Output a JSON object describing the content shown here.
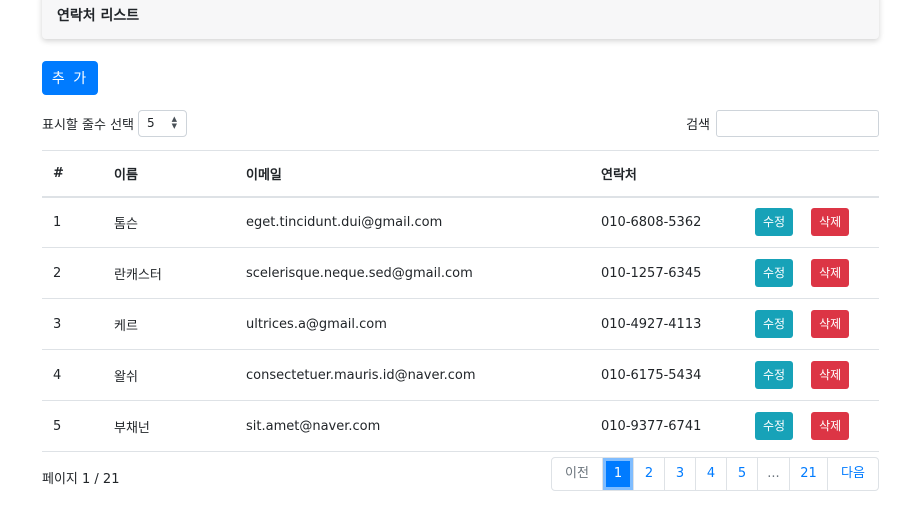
{
  "card": {
    "title": "연락처 리스트"
  },
  "toolbar": {
    "add_label": "추 가",
    "rows_label": "표시할 줄수 선택",
    "rows_value": "5",
    "search_label": "검색",
    "search_value": ""
  },
  "table": {
    "headers": [
      "#",
      "이름",
      "이메일",
      "연락처"
    ],
    "edit_label": "수정",
    "delete_label": "삭제",
    "rows": [
      {
        "num": "1",
        "name": "톰슨",
        "email": "eget.tincidunt.dui@gmail.com",
        "phone": "010-6808-5362"
      },
      {
        "num": "2",
        "name": "란캐스터",
        "email": "scelerisque.neque.sed@gmail.com",
        "phone": "010-1257-6345"
      },
      {
        "num": "3",
        "name": "케르",
        "email": "ultrices.a@gmail.com",
        "phone": "010-4927-4113"
      },
      {
        "num": "4",
        "name": "왈쉬",
        "email": "consectetuer.mauris.id@naver.com",
        "phone": "010-6175-5434"
      },
      {
        "num": "5",
        "name": "부채넌",
        "email": "sit.amet@naver.com",
        "phone": "010-9377-6741"
      }
    ]
  },
  "pagination": {
    "info": "페이지 1 / 21",
    "prev_label": "이전",
    "pages": [
      "1",
      "2",
      "3",
      "4",
      "5"
    ],
    "ellipsis": "...",
    "last_page": "21",
    "next_label": "다음",
    "current": "1"
  },
  "colors": {
    "primary": "#007bff",
    "info": "#17a2b8",
    "danger": "#dc3545"
  }
}
